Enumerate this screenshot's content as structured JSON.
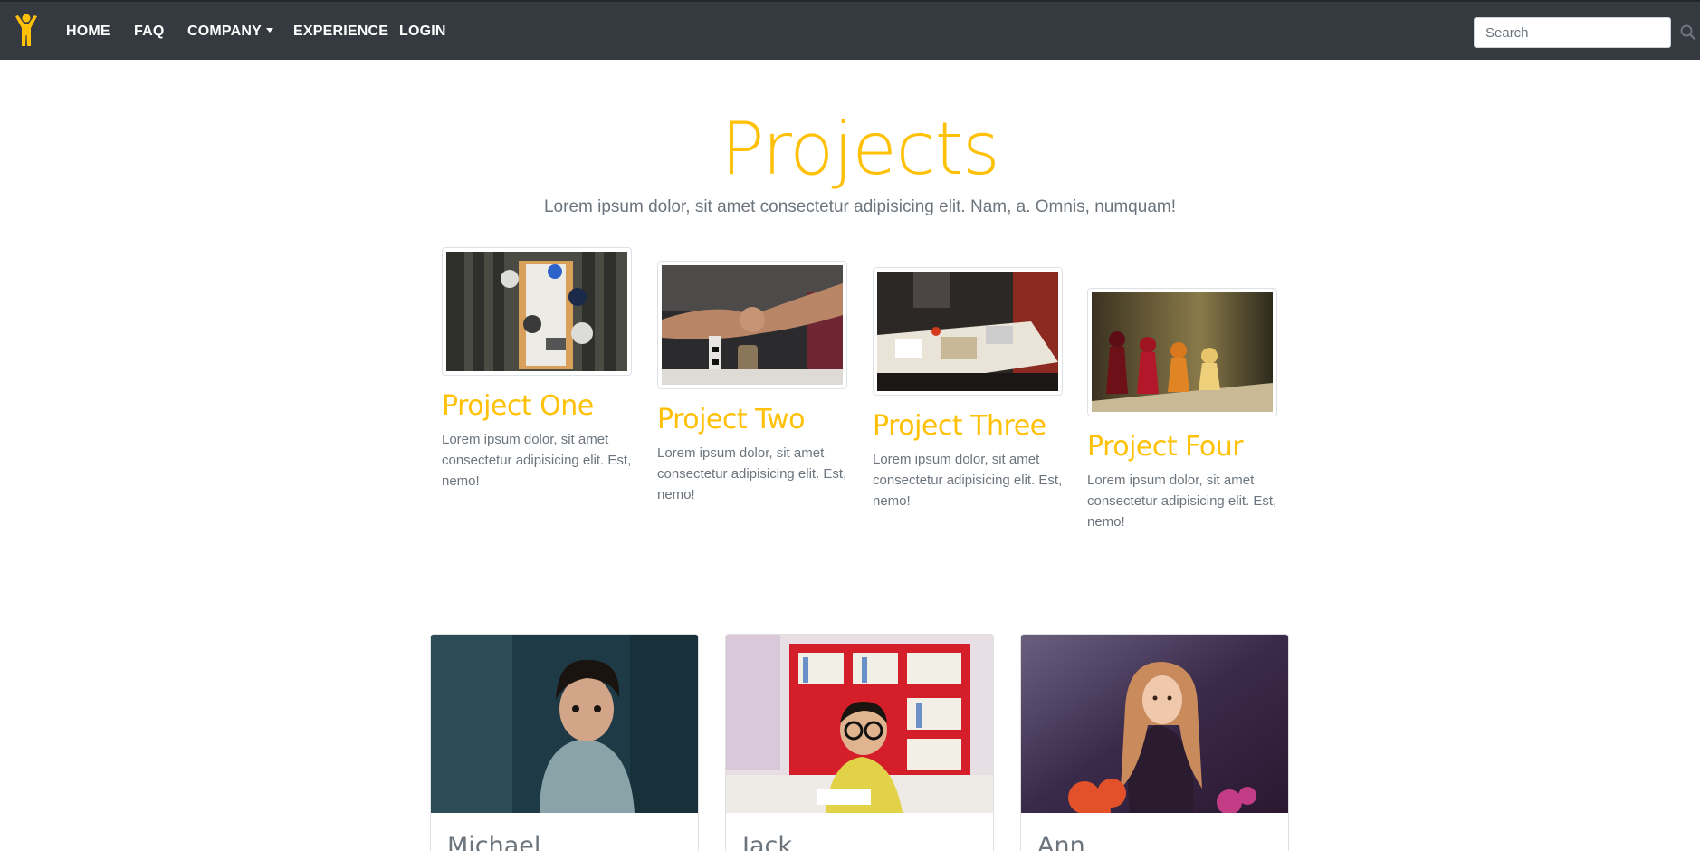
{
  "navbar": {
    "logo_icon": "person-arms-raised-icon",
    "brand_color": "#ffc107",
    "links": [
      "HOME",
      "FAQ",
      "COMPANY",
      "EXPERIENCE",
      "LOGIN"
    ],
    "search_placeholder": "Search",
    "search_icon": "search-icon"
  },
  "header": {
    "title": "Projects",
    "subtitle": "Lorem ipsum dolor, sit amet consectetur adipisicing elit. Nam, a. Omnis, numquam!"
  },
  "projects": [
    {
      "title": "Project One",
      "text": "Lorem ipsum dolor, sit amet consectetur adipisicing elit. Est, nemo!"
    },
    {
      "title": "Project Two",
      "text": "Lorem ipsum dolor, sit amet consectetur adipisicing elit. Est, nemo!"
    },
    {
      "title": "Project Three",
      "text": "Lorem ipsum dolor, sit amet consectetur adipisicing elit. Est, nemo!"
    },
    {
      "title": "Project Four",
      "text": "Lorem ipsum dolor, sit amet consectetur adipisicing elit. Est, nemo!"
    }
  ],
  "people": [
    {
      "name": "Michael"
    },
    {
      "name": "Jack"
    },
    {
      "name": "Ann"
    }
  ],
  "colors": {
    "navbar_bg": "#343a40",
    "accent": "#ffc107",
    "muted_text": "#6c757d"
  }
}
